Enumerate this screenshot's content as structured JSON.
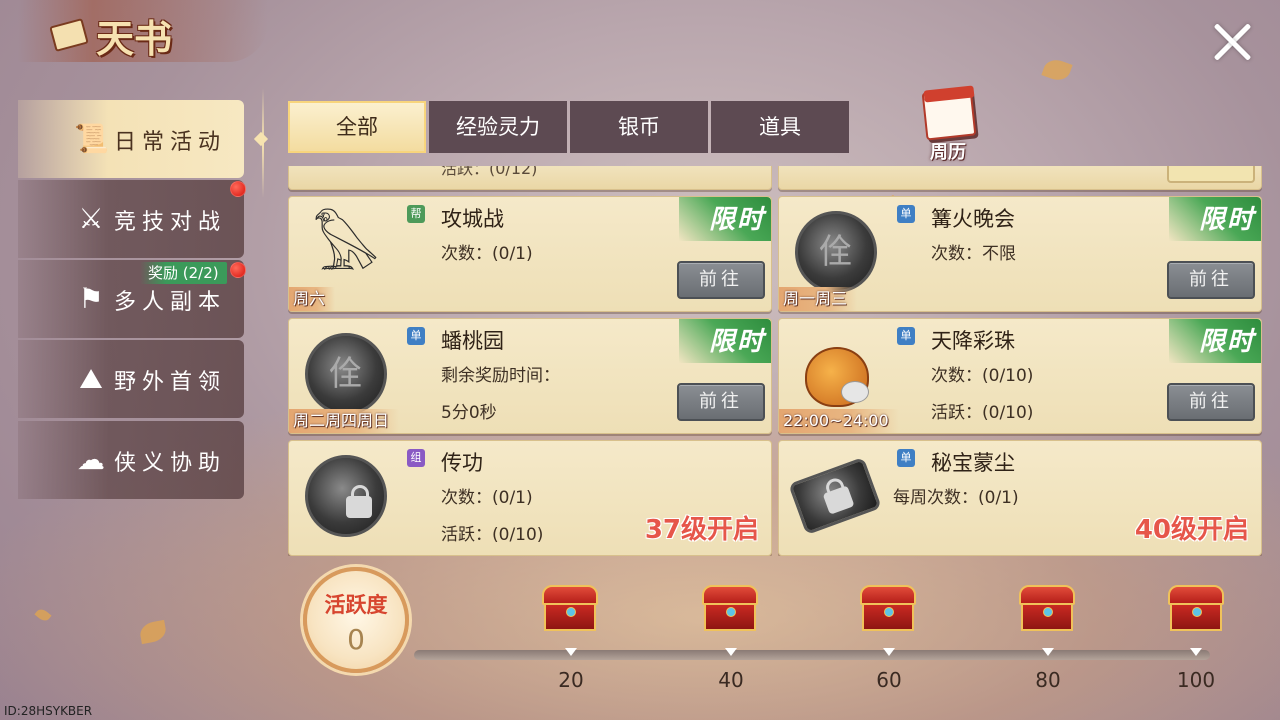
{
  "window": {
    "title": "天书"
  },
  "sidebar": {
    "items": [
      {
        "label": "日常活动",
        "icon": "scroll-icon",
        "active": true
      },
      {
        "label": "竞技对战",
        "icon": "crossed-swords-icon",
        "active": false,
        "red_dot": true
      },
      {
        "label": "多人副本",
        "icon": "flag-icon",
        "active": false,
        "red_dot": true,
        "badge": "奖励 (2/2)"
      },
      {
        "label": "野外首领",
        "icon": "mountain-icon",
        "active": false
      },
      {
        "label": "侠义协助",
        "icon": "helmet-icon",
        "active": false
      }
    ]
  },
  "tabs": [
    {
      "label": "全部",
      "active": true
    },
    {
      "label": "经验灵力",
      "active": false
    },
    {
      "label": "银币",
      "active": false
    },
    {
      "label": "道具",
      "active": false
    }
  ],
  "calendar": {
    "label": "周历",
    "icon": "calendar-icon"
  },
  "stubs": [
    {
      "text": "活跃：(0/12)"
    }
  ],
  "activities": [
    {
      "name": "攻城战",
      "type_badge": "帮",
      "type_color": "#4e9a5a",
      "line1": "次数：(0/1)",
      "line2": "",
      "days": "周六",
      "limited": "限时",
      "button": "前往",
      "icon": "phoenix-icon"
    },
    {
      "name": "篝火晚会",
      "type_badge": "单",
      "type_color": "#3f7fc4",
      "line1": "次数：不限",
      "line2": "",
      "days": "周一周三",
      "limited": "限时",
      "button": "前往",
      "icon": "seal-icon"
    },
    {
      "name": "蟠桃园",
      "type_badge": "单",
      "type_color": "#3f7fc4",
      "line1": "剩余奖励时间：",
      "line2": "5分0秒",
      "days": "周二周四周日",
      "limited": "限时",
      "button": "前往",
      "icon": "seal-icon"
    },
    {
      "name": "天降彩珠",
      "type_badge": "单",
      "type_color": "#3f7fc4",
      "line1": "次数：(0/10)",
      "line2": "活跃：(0/10)",
      "days": "22:00~24:00",
      "limited": "限时",
      "button": "前往",
      "icon": "treasure-bag-icon"
    },
    {
      "name": "传功",
      "type_badge": "组",
      "type_color": "#8a5ac4",
      "line1": "次数：(0/1)",
      "line2": "活跃：(0/10)",
      "days": "",
      "open_level": "37级开启",
      "icon": "locked-seal-icon"
    },
    {
      "name": "秘宝蒙尘",
      "type_badge": "单",
      "type_color": "#3f7fc4",
      "line1": "每周次数：(0/1)",
      "line2": "",
      "days": "",
      "open_level": "40级开启",
      "icon": "scroll-map-icon"
    }
  ],
  "activity_meter": {
    "title": "活跃度",
    "value": "0",
    "progress": 0,
    "max": 100,
    "milestones": [
      "20",
      "40",
      "60",
      "80",
      "100"
    ]
  },
  "footer": {
    "id": "ID:28HSYKBER"
  },
  "colors": {
    "accent": "#f3dca0",
    "limited_green": "#2e8d3e",
    "open_level_red": "#e6564a",
    "red_dot": "#d8130c"
  }
}
